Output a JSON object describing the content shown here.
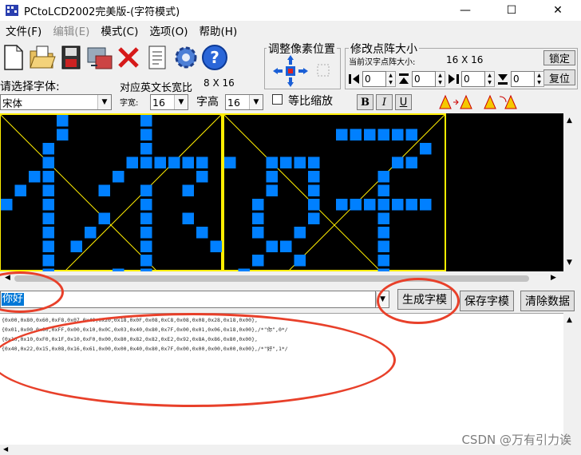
{
  "window": {
    "title": "PCtoLCD2002完美版-(字符模式)",
    "minimize": "—",
    "maximize": "☐",
    "close": "✕"
  },
  "menu": [
    {
      "label": "文件(F)",
      "disabled": false
    },
    {
      "label": "编辑(E)",
      "disabled": true
    },
    {
      "label": "模式(C)",
      "disabled": false
    },
    {
      "label": "选项(O)",
      "disabled": false
    },
    {
      "label": "帮助(H)",
      "disabled": false
    }
  ],
  "toolbar": {
    "icons": [
      "new-file-icon",
      "open-folder-icon",
      "save-disk-icon",
      "export-icon",
      "delete-icon",
      "notes-icon",
      "settings-gear-icon",
      "help-icon"
    ]
  },
  "font": {
    "prompt": "请选择字体:",
    "selected": "宋体"
  },
  "english": {
    "label": "对应英文长宽比",
    "ratio": "8 X 16",
    "width_label": "字宽:",
    "width_val": "16",
    "height_label": "字高",
    "height_val": "16",
    "proportional": "等比缩放"
  },
  "format": {
    "bold": "B",
    "italic": "I",
    "underline": "U"
  },
  "pixel_pos": {
    "title": "调整像素位置"
  },
  "resize": {
    "title": "修改点阵大小",
    "current_label": "当前汉字点阵大小:",
    "current_val": "16 X 16",
    "lock": "锁定",
    "reset": "复位",
    "spins": [
      "0",
      "0",
      "0",
      "0"
    ]
  },
  "canvas": {
    "grid_color": "#ffee00",
    "pixel_color": "#0080ff"
  },
  "input": {
    "value": "你好"
  },
  "buttons": {
    "generate": "生成字模",
    "save": "保存字模",
    "clear": "清除数据"
  },
  "output_lines": [
    "{0x00,0x80,0x60,0xF8,0x07,0x40,0x20,0x18,0x0F,0x08,0xC8,0x08,0x08,0x28,0x18,0x00},",
    "{0x01,0x00,0x00,0xFF,0x00,0x10,0x0C,0x03,0x40,0x80,0x7F,0x00,0x01,0x06,0x18,0x00},/*\"你\",0*/",
    "{0x10,0x10,0xF0,0x1F,0x10,0xF0,0x00,0x80,0x82,0x82,0xE2,0x92,0x8A,0x86,0x80,0x00},",
    "{0x40,0x22,0x15,0x08,0x16,0x61,0x00,0x00,0x40,0x80,0x7F,0x00,0x00,0x00,0x00,0x00},/*\"好\",1*/"
  ],
  "watermark": "CSDN @万有引力诶"
}
